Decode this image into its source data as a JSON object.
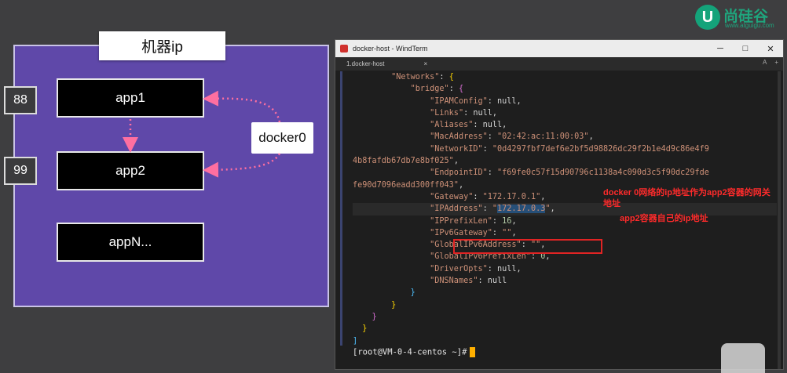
{
  "diagram": {
    "machine_title": "机器ip",
    "apps": [
      "app1",
      "app2",
      "appN..."
    ],
    "ports": [
      "88",
      "99"
    ],
    "bridge_label": "docker0"
  },
  "logo": {
    "badge": "U",
    "name": "尚硅谷",
    "url": "www.atguigu.com"
  },
  "terminal": {
    "window_title": "docker-host - WindTerm",
    "tab_label": "1.docker-host",
    "buttons": {
      "minimize": "─",
      "maximize": "□",
      "close": "✕"
    },
    "tab_right": [
      "A",
      "+"
    ],
    "lines": [
      {
        "indent": "        ",
        "parts": [
          [
            "s",
            "\"Networks\""
          ],
          [
            "k",
            ": "
          ],
          [
            "b1",
            "{"
          ]
        ]
      },
      {
        "indent": "            ",
        "parts": [
          [
            "s",
            "\"bridge\""
          ],
          [
            "k",
            ": "
          ],
          [
            "b2",
            "{"
          ]
        ]
      },
      {
        "indent": "                ",
        "parts": [
          [
            "s",
            "\"IPAMConfig\""
          ],
          [
            "k",
            ": null,"
          ]
        ]
      },
      {
        "indent": "                ",
        "parts": [
          [
            "s",
            "\"Links\""
          ],
          [
            "k",
            ": null,"
          ]
        ]
      },
      {
        "indent": "                ",
        "parts": [
          [
            "s",
            "\"Aliases\""
          ],
          [
            "k",
            ": null,"
          ]
        ]
      },
      {
        "indent": "                ",
        "parts": [
          [
            "s",
            "\"MacAddress\""
          ],
          [
            "k",
            ": "
          ],
          [
            "s",
            "\"02:42:ac:11:00:03\""
          ],
          [
            "k",
            ","
          ]
        ]
      },
      {
        "indent": "                ",
        "parts": [
          [
            "s",
            "\"NetworkID\""
          ],
          [
            "k",
            ": "
          ],
          [
            "s",
            "\"0d4297fbf7def6e2bf5d98826dc29f2b1e4d9c86e4f9"
          ]
        ]
      },
      {
        "indent": "",
        "parts": [
          [
            "s",
            "4b8fafdb67db7e8bf025\""
          ],
          [
            "k",
            ","
          ]
        ]
      },
      {
        "indent": "                ",
        "parts": [
          [
            "s",
            "\"EndpointID\""
          ],
          [
            "k",
            ": "
          ],
          [
            "s",
            "\"f69fe0c57f15d90796c1138a4c090d3c5f90dc29fde"
          ]
        ]
      },
      {
        "indent": "",
        "parts": [
          [
            "s",
            "fe90d7096eadd300ff043\""
          ],
          [
            "k",
            ","
          ]
        ]
      },
      {
        "indent": "                ",
        "parts": [
          [
            "s",
            "\"Gateway\""
          ],
          [
            "k",
            ": "
          ],
          [
            "s",
            "\"172.17.0.1\""
          ],
          [
            "k",
            ","
          ]
        ]
      },
      {
        "indent": "                ",
        "parts": [
          [
            "s",
            "\"IPAddress\""
          ],
          [
            "k",
            ": "
          ],
          [
            "s",
            "\""
          ],
          [
            "sel",
            "172.17.0.3"
          ],
          [
            "s",
            "\""
          ],
          [
            "k",
            ","
          ]
        ],
        "highlight": true
      },
      {
        "indent": "                ",
        "parts": [
          [
            "s",
            "\"IPPrefixLen\""
          ],
          [
            "k",
            ": "
          ],
          [
            "n",
            "16"
          ],
          [
            "k",
            ","
          ]
        ]
      },
      {
        "indent": "                ",
        "parts": [
          [
            "s",
            "\"IPv6Gateway\""
          ],
          [
            "k",
            ": "
          ],
          [
            "s",
            "\"\""
          ],
          [
            "k",
            ","
          ]
        ]
      },
      {
        "indent": "                ",
        "parts": [
          [
            "s",
            "\"GlobalIPv6Address\""
          ],
          [
            "k",
            ": "
          ],
          [
            "s",
            "\"\""
          ],
          [
            "k",
            ","
          ]
        ]
      },
      {
        "indent": "                ",
        "parts": [
          [
            "s",
            "\"GlobalIPv6PrefixLen\""
          ],
          [
            "k",
            ": "
          ],
          [
            "n",
            "0"
          ],
          [
            "k",
            ","
          ]
        ]
      },
      {
        "indent": "                ",
        "parts": [
          [
            "s",
            "\"DriverOpts\""
          ],
          [
            "k",
            ": null,"
          ]
        ]
      },
      {
        "indent": "                ",
        "parts": [
          [
            "s",
            "\"DNSNames\""
          ],
          [
            "k",
            ": null"
          ]
        ]
      },
      {
        "indent": "            ",
        "parts": [
          [
            "b3",
            "}"
          ]
        ]
      },
      {
        "indent": "        ",
        "parts": [
          [
            "b1",
            "}"
          ]
        ]
      },
      {
        "indent": "    ",
        "parts": [
          [
            "b2",
            "}"
          ]
        ]
      },
      {
        "indent": "  ",
        "parts": [
          [
            "b1",
            "}"
          ]
        ]
      },
      {
        "indent": "",
        "parts": [
          [
            "b3",
            "]"
          ]
        ]
      }
    ],
    "prompt": "[root@VM-0-4-centos ~]#"
  },
  "annotations": {
    "gateway_note_line1": "docker 0网络的ip地址作为app2容器的网关",
    "gateway_note_line2": "地址",
    "ip_note": "app2容器自己的ip地址"
  },
  "colors": {
    "machine_bg": "#5f48a9",
    "arrow": "#ff6fa0",
    "annotation": "#ff2b2b"
  }
}
